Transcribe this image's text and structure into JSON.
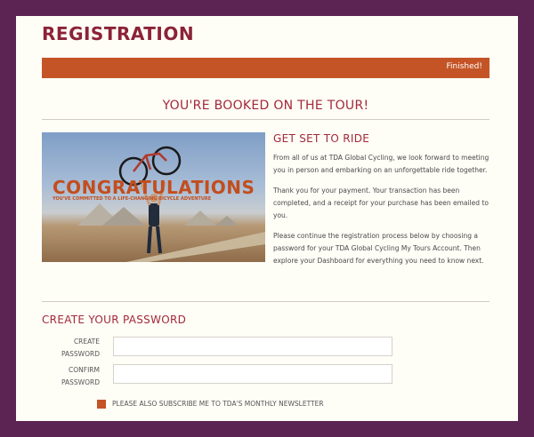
{
  "page": {
    "title": "REGISTRATION",
    "progress_text": "Finished!",
    "booked_heading": "YOU'RE BOOKED ON THE TOUR!"
  },
  "hero": {
    "headline": "CONGRATULATIONS",
    "subline": "YOU'VE COMMITTED TO A LIFE-CHANGING BICYCLE ADVENTURE"
  },
  "side": {
    "heading": "GET SET TO RIDE",
    "paragraphs": [
      "From all of us at TDA Global Cycling, we look forward to meeting you in person and embarking on an unforgettable ride together.",
      "Thank you for your payment. Your transaction has been completed, and a receipt for your purchase has been emailed to you.",
      "Please continue the registration process below by choosing a password for your TDA Global Cycling My Tours Account. Then explore your Dashboard for everything you need to know next."
    ]
  },
  "password": {
    "heading": "CREATE YOUR PASSWORD",
    "create_label_1": "CREATE",
    "create_label_2": "PASSWORD",
    "confirm_label_1": "CONFIRM",
    "confirm_label_2": "PASSWORD",
    "create_value": "",
    "confirm_value": "",
    "newsletter_label": "PLEASE ALSO SUBSCRIBE ME TO TDA'S MONTHLY NEWSLETTER",
    "newsletter_checked": true
  },
  "colors": {
    "background": "#5b2452",
    "accent": "#c45426",
    "heading": "#a3293a",
    "card": "#fefdf6"
  }
}
